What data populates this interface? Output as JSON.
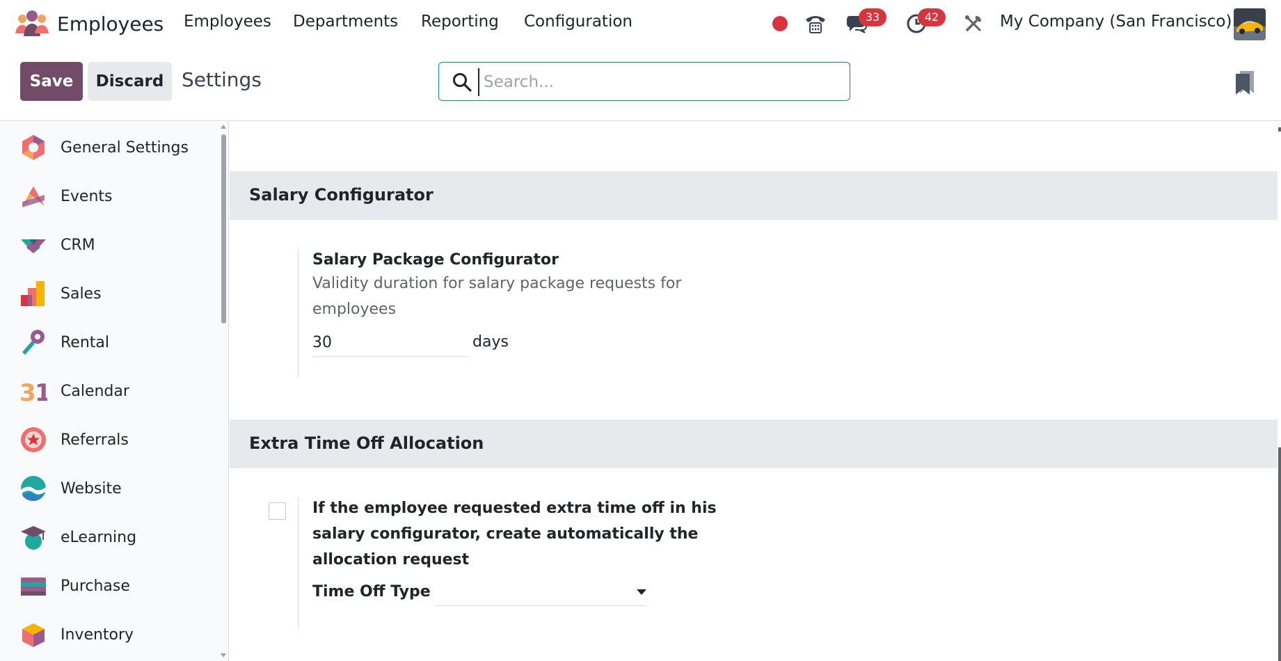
{
  "navbar": {
    "app_name": "Employees",
    "menu": [
      "Employees",
      "Departments",
      "Reporting",
      "Configuration"
    ],
    "messages_count": "33",
    "activities_count": "42",
    "company": "My Company (San Francisco)"
  },
  "control": {
    "save_label": "Save",
    "discard_label": "Discard",
    "title": "Settings",
    "search_placeholder": "Search...",
    "search_value": ""
  },
  "sidebar": {
    "items": [
      {
        "label": "General Settings",
        "icon": "general-settings-icon"
      },
      {
        "label": "Events",
        "icon": "events-icon"
      },
      {
        "label": "CRM",
        "icon": "crm-icon"
      },
      {
        "label": "Sales",
        "icon": "sales-icon"
      },
      {
        "label": "Rental",
        "icon": "rental-icon"
      },
      {
        "label": "Calendar",
        "icon": "calendar-icon"
      },
      {
        "label": "Referrals",
        "icon": "referrals-icon"
      },
      {
        "label": "Website",
        "icon": "website-icon"
      },
      {
        "label": "eLearning",
        "icon": "elearning-icon"
      },
      {
        "label": "Purchase",
        "icon": "purchase-icon"
      },
      {
        "label": "Inventory",
        "icon": "inventory-icon"
      }
    ]
  },
  "sections": {
    "salary": {
      "title": "Salary Configurator",
      "setting_title": "Salary Package Configurator",
      "setting_desc": "Validity duration for salary package requests for employees",
      "days_value": "30",
      "days_unit": "days"
    },
    "timeoff": {
      "title": "Extra Time Off Allocation",
      "checkbox_label": "If the employee requested extra time off in his salary configurator, create automatically the allocation request",
      "checked": false,
      "type_label": "Time Off Type",
      "type_value": ""
    }
  },
  "colors": {
    "brand": "#714b67",
    "badge": "#d7343d",
    "section_bg": "#e7e9ed",
    "search_border": "#0d8f8f"
  }
}
